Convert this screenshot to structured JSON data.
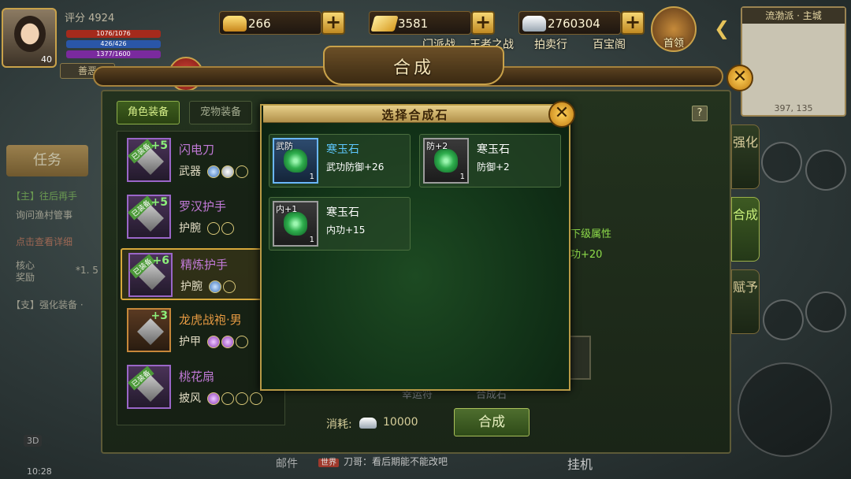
{
  "player": {
    "score_label": "评分 4924",
    "level": "40",
    "hp_text": "1076/1076",
    "mp_text": "426/426",
    "exp_text": "1377/1600",
    "morality": "善恶"
  },
  "currencies": [
    {
      "icon": "gold-ingot-icon",
      "value": "266"
    },
    {
      "icon": "gold-bar-icon",
      "value": "3581"
    },
    {
      "icon": "silver-ingot-icon",
      "value": "2760304"
    }
  ],
  "top_menu": {
    "items": [
      "门派战",
      "王者之战",
      "拍卖行",
      "百宝阁"
    ],
    "first_recharge": "首领"
  },
  "minimap": {
    "title": "流渤派 · 主城",
    "coords": "397, 135"
  },
  "left_hud": {
    "task_button": "任务",
    "quest_main": "【主】往后再手",
    "quest_main_sub": "询问渔村管事",
    "quest_alert": "点击查看详细",
    "core_reward": "核心奖励",
    "reward_count": "*1. 5",
    "quest_side": "【支】强化装备 ·"
  },
  "bottom_hud": {
    "mode_badge": "3D",
    "time": "10:28",
    "mail": "邮件",
    "chat_tag": "世界",
    "chat_text": "刀哥：看后期能不能改吧",
    "hangup": "挂机"
  },
  "window": {
    "title": "合成",
    "tabs": [
      "角色装备",
      "宠物装备"
    ],
    "help": "?",
    "side_tabs": [
      "强化",
      "合成",
      "赋予"
    ],
    "next_level_attr": "下级属性",
    "next_level_value": "功+20",
    "hidden_label_1": "幸运符",
    "hidden_label_2": "合成石",
    "cost_label": "消耗:",
    "cost_value": "10000",
    "synth_button": "合成"
  },
  "equipment": [
    {
      "ribbon": "已装备",
      "plus": "+5",
      "name": "闪电刀",
      "type": "武器",
      "rarity": "purple",
      "gems": [
        "blue",
        "silver",
        "empty"
      ]
    },
    {
      "ribbon": "已装备",
      "plus": "+5",
      "name": "罗汉护手",
      "type": "护腕",
      "rarity": "purple",
      "gems": [
        "empty",
        "empty"
      ]
    },
    {
      "ribbon": "已装备",
      "plus": "+6",
      "name": "精炼护手",
      "type": "护腕",
      "rarity": "purple",
      "gems": [
        "blue",
        "empty"
      ]
    },
    {
      "ribbon": "已装备",
      "plus": "+3",
      "name": "龙虎战袍·男",
      "type": "护甲",
      "rarity": "orange",
      "gems": [
        "purple",
        "purple",
        "empty"
      ]
    },
    {
      "ribbon": "已装备",
      "plus": "",
      "name": "桃花扇",
      "type": "披风",
      "rarity": "purple",
      "gems": [
        "purple",
        "empty",
        "empty",
        "empty"
      ]
    }
  ],
  "popup": {
    "title": "选择合成石",
    "stones": [
      {
        "tag": "武防",
        "name": "寒玉石",
        "attr": "武功防御+26",
        "count": "1",
        "selected": true
      },
      {
        "tag": "防+2",
        "name": "寒玉石",
        "attr": "防御+2",
        "count": "1",
        "selected": false
      },
      {
        "tag": "内+1",
        "name": "寒玉石",
        "attr": "内功+15",
        "count": "1",
        "selected": false
      }
    ]
  }
}
